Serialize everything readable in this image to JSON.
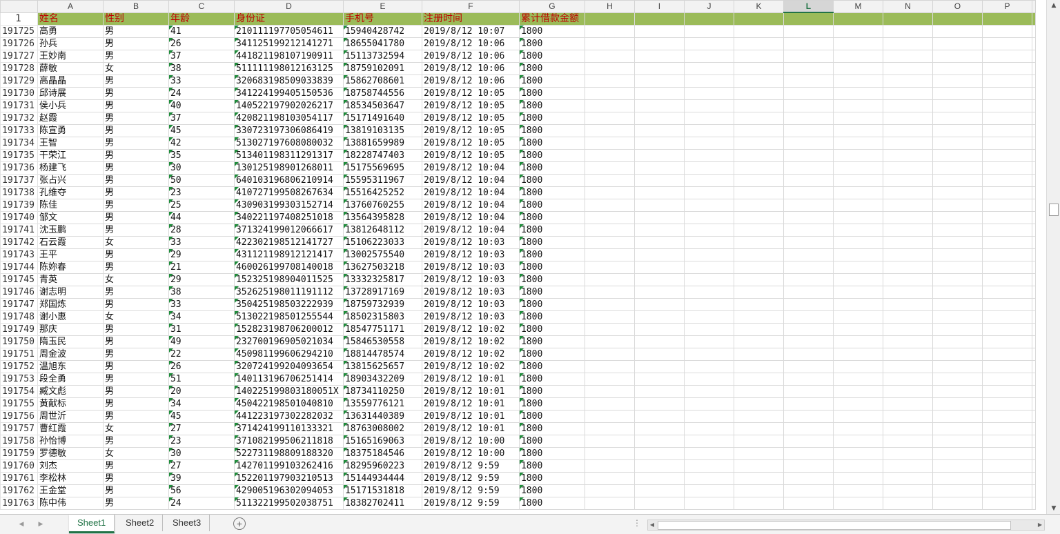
{
  "columns": [
    "A",
    "B",
    "C",
    "D",
    "E",
    "F",
    "G",
    "H",
    "I",
    "J",
    "K",
    "L",
    "M",
    "N",
    "O",
    "P"
  ],
  "selected_column": "L",
  "header_row": {
    "row_number": "1",
    "cells": [
      "姓名",
      "性别",
      "年龄",
      "身份证",
      "手机号",
      "注册时间",
      "累计借款金额",
      "",
      "",
      "",
      "",
      "",
      "",
      "",
      "",
      ""
    ]
  },
  "rows": [
    [
      "191725",
      "高勇",
      "男",
      "41",
      "210111197705054611",
      "15940428742",
      "2019/8/12 10:07",
      "1800"
    ],
    [
      "191726",
      "孙兵",
      "男",
      "26",
      "341125199212141271",
      "18655041780",
      "2019/8/12 10:06",
      "1800"
    ],
    [
      "191727",
      "王妙南",
      "男",
      "37",
      "441821198107190911",
      "15113732594",
      "2019/8/12 10:06",
      "1800"
    ],
    [
      "191728",
      "薛敏",
      "女",
      "38",
      "511111198012163125",
      "18759102091",
      "2019/8/12 10:06",
      "1800"
    ],
    [
      "191729",
      "高晶晶",
      "男",
      "33",
      "320683198509033839",
      "15862708601",
      "2019/8/12 10:06",
      "1800"
    ],
    [
      "191730",
      "邱诗展",
      "男",
      "24",
      "341224199405150536",
      "18758744556",
      "2019/8/12 10:05",
      "1800"
    ],
    [
      "191731",
      "侯小兵",
      "男",
      "40",
      "140522197902026217",
      "18534503647",
      "2019/8/12 10:05",
      "1800"
    ],
    [
      "191732",
      "赵霞",
      "男",
      "37",
      "420821198103054117",
      "15171491640",
      "2019/8/12 10:05",
      "1800"
    ],
    [
      "191733",
      "陈宣勇",
      "男",
      "45",
      "330723197306086419",
      "13819103135",
      "2019/8/12 10:05",
      "1800"
    ],
    [
      "191734",
      "王智",
      "男",
      "42",
      "513027197608080032",
      "13881659989",
      "2019/8/12 10:05",
      "1800"
    ],
    [
      "191735",
      "干荣江",
      "男",
      "35",
      "513401198311291317",
      "18228747403",
      "2019/8/12 10:05",
      "1800"
    ],
    [
      "191736",
      "杨建飞",
      "男",
      "30",
      "130125198901268011",
      "15175569695",
      "2019/8/12 10:04",
      "1800"
    ],
    [
      "191737",
      "张占兴",
      "男",
      "50",
      "640103196806210914",
      "15595311967",
      "2019/8/12 10:04",
      "1800"
    ],
    [
      "191738",
      "孔维夺",
      "男",
      "23",
      "410727199508267634",
      "15516425252",
      "2019/8/12 10:04",
      "1800"
    ],
    [
      "191739",
      "陈佳",
      "男",
      "25",
      "430903199303152714",
      "13760760255",
      "2019/8/12 10:04",
      "1800"
    ],
    [
      "191740",
      "邹文",
      "男",
      "44",
      "340221197408251018",
      "13564395828",
      "2019/8/12 10:04",
      "1800"
    ],
    [
      "191741",
      "沈玉鹏",
      "男",
      "28",
      "371324199012066617",
      "13812648112",
      "2019/8/12 10:04",
      "1800"
    ],
    [
      "191742",
      "石云霞",
      "女",
      "33",
      "422302198512141727",
      "15106223033",
      "2019/8/12 10:03",
      "1800"
    ],
    [
      "191743",
      "王平",
      "男",
      "29",
      "431121198912121417",
      "13002575540",
      "2019/8/12 10:03",
      "1800"
    ],
    [
      "191744",
      "陈妳春",
      "男",
      "21",
      "460026199708140018",
      "13627503218",
      "2019/8/12 10:03",
      "1800"
    ],
    [
      "191745",
      "青英",
      "女",
      "29",
      "152325198904011525",
      "13332325817",
      "2019/8/12 10:03",
      "1800"
    ],
    [
      "191746",
      "谢志明",
      "男",
      "38",
      "352625198011191112",
      "13728917169",
      "2019/8/12 10:03",
      "1800"
    ],
    [
      "191747",
      "郑国炼",
      "男",
      "33",
      "350425198503222939",
      "18759732939",
      "2019/8/12 10:03",
      "1800"
    ],
    [
      "191748",
      "谢小惠",
      "女",
      "34",
      "513022198501255544",
      "18502315803",
      "2019/8/12 10:03",
      "1800"
    ],
    [
      "191749",
      "那庆",
      "男",
      "31",
      "152823198706200012",
      "18547751171",
      "2019/8/12 10:02",
      "1800"
    ],
    [
      "191750",
      "隋玉民",
      "男",
      "49",
      "232700196905021034",
      "15846530558",
      "2019/8/12 10:02",
      "1800"
    ],
    [
      "191751",
      "周金波",
      "男",
      "22",
      "450981199606294210",
      "18814478574",
      "2019/8/12 10:02",
      "1800"
    ],
    [
      "191752",
      "温旭东",
      "男",
      "26",
      "320724199204093654",
      "13815625657",
      "2019/8/12 10:02",
      "1800"
    ],
    [
      "191753",
      "段全勇",
      "男",
      "51",
      "140113196706251414",
      "18903432209",
      "2019/8/12 10:01",
      "1800"
    ],
    [
      "191754",
      "臧文彪",
      "男",
      "20",
      "140225199803180051X",
      "18734110250",
      "2019/8/12 10:01",
      "1800"
    ],
    [
      "191755",
      "黄献标",
      "男",
      "34",
      "450422198501040810",
      "13559776121",
      "2019/8/12 10:01",
      "1800"
    ],
    [
      "191756",
      "周世沂",
      "男",
      "45",
      "441223197302282032",
      "13631440389",
      "2019/8/12 10:01",
      "1800"
    ],
    [
      "191757",
      "曹红霞",
      "女",
      "27",
      "371424199110133321",
      "18763008002",
      "2019/8/12 10:01",
      "1800"
    ],
    [
      "191758",
      "孙怡博",
      "男",
      "23",
      "371082199506211818",
      "15165169063",
      "2019/8/12 10:00",
      "1800"
    ],
    [
      "191759",
      "罗德敏",
      "女",
      "30",
      "522731198809188320",
      "18375184546",
      "2019/8/12 10:00",
      "1800"
    ],
    [
      "191760",
      "刘杰",
      "男",
      "27",
      "142701199103262416",
      "18295960223",
      "2019/8/12 9:59",
      "1800"
    ],
    [
      "191761",
      "李松林",
      "男",
      "39",
      "152201197903210513",
      "15144934444",
      "2019/8/12 9:59",
      "1800"
    ],
    [
      "191762",
      "王金堂",
      "男",
      "56",
      "429005196302094053",
      "15171531818",
      "2019/8/12 9:59",
      "1800"
    ],
    [
      "191763",
      "陈中伟",
      "男",
      "24",
      "511322199502038751",
      "18382702411",
      "2019/8/12 9:59",
      "1800"
    ]
  ],
  "sheet_tabs": [
    "Sheet1",
    "Sheet2",
    "Sheet3"
  ],
  "active_sheet": "Sheet1",
  "icons": {
    "prev_sheet": "caret-left-icon",
    "next_sheet": "caret-right-icon",
    "add_sheet": "plus-circle-icon",
    "more": "ellipsis-vertical-icon"
  },
  "colors": {
    "header_fill": "#9bbb59",
    "header_text": "#c00000",
    "accent": "#217346",
    "error_triangle": "#1e8c3a"
  }
}
